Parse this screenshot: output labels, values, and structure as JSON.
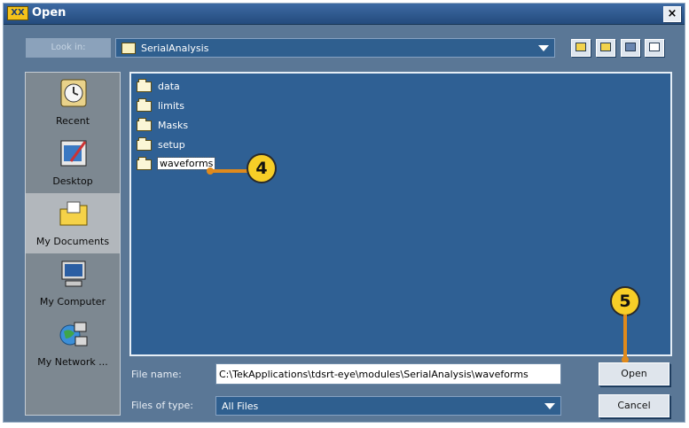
{
  "window": {
    "title": "Open",
    "app_icon_text": "XX"
  },
  "toolbar": {
    "look_in_label": "Look in:",
    "current_folder": "SerialAnalysis",
    "buttons": [
      "up-one-level",
      "create-new-folder",
      "list-view",
      "details-view"
    ]
  },
  "places": [
    {
      "label": "Recent",
      "icon": "recent-icon"
    },
    {
      "label": "Desktop",
      "icon": "desktop-icon"
    },
    {
      "label": "My Documents",
      "icon": "my-documents-icon",
      "active": true
    },
    {
      "label": "My Computer",
      "icon": "my-computer-icon"
    },
    {
      "label": "My Network ...",
      "icon": "my-network-icon"
    }
  ],
  "files": [
    {
      "name": "data"
    },
    {
      "name": "limits"
    },
    {
      "name": "Masks"
    },
    {
      "name": "setup"
    },
    {
      "name": "waveforms",
      "selected": true
    }
  ],
  "callouts": {
    "step_a": "4",
    "step_b": "5"
  },
  "filename": {
    "label": "File name:",
    "value": "C:\\TekApplications\\tdsrt-eye\\modules\\SerialAnalysis\\waveforms"
  },
  "filetype": {
    "label": "Files of type:",
    "value": "All Files"
  },
  "buttons": {
    "open": "Open",
    "cancel": "Cancel"
  },
  "colors": {
    "dialog_bg": "#5a7796",
    "list_bg": "#2f6094",
    "callout": "#f7ce27",
    "callout_line": "#e08a1c"
  }
}
